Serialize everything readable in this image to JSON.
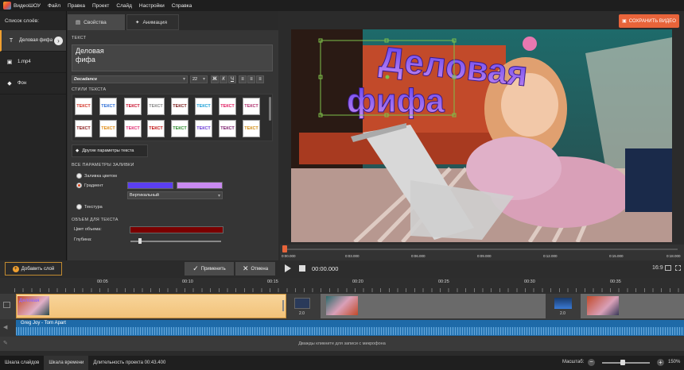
{
  "menu": {
    "app": "ВидеоШОУ",
    "items": [
      "Файл",
      "Правка",
      "Проект",
      "Слайд",
      "Настройки",
      "Справка"
    ]
  },
  "left": {
    "header": "Список слоёв:",
    "layers": [
      {
        "label": "Деловая фифа",
        "icon": "T"
      },
      {
        "label": "1.mp4",
        "icon": "film-icon"
      },
      {
        "label": "Фон",
        "icon": "paint-bucket-icon"
      }
    ]
  },
  "props": {
    "tab_properties": "Свойства",
    "tab_animation": "Анимация",
    "text_label": "ТЕКСТ",
    "text_value": "Деловая\nфифа",
    "font": "Decadance",
    "size": "22",
    "styles_label": "СТИЛИ ТЕКСТА",
    "style_word": "ТЕКСТ",
    "more_params": "Другие параметры текста",
    "fill_label": "ВСЕ ПАРАМЕТРЫ ЗАЛИВКИ",
    "fill_color": "Заливка цветом",
    "gradient": "Градиент",
    "gradient_type": "Вертикальный",
    "texture": "Текстура",
    "volume_label": "ОБЪЕМ ДЛЯ ТЕКСТА",
    "volume_color": "Цвет объема:",
    "depth": "Глубина:",
    "grad_color1": "#5b3ff0",
    "grad_color2": "#c98af0",
    "volume_swatch": "#7a0000"
  },
  "preview": {
    "title_line1": "Деловая",
    "title_line2": "фифа"
  },
  "save_button": "СОХРАНИТЬ ВИДЕО",
  "preview_ruler": [
    "0:00.000",
    "0:03.000",
    "0:06.000",
    "0:09.000",
    "0:12.000",
    "0:15.000",
    "0:18.000"
  ],
  "player": {
    "time": "00:00.000",
    "ratio": "16:9"
  },
  "bottom": {
    "add_layer": "Добавить слой",
    "apply": "Применить",
    "cancel": "Отмена"
  },
  "timeline_ruler": [
    "00:05",
    "00:10",
    "00:15",
    "00:20",
    "00:25",
    "00:30",
    "00:35"
  ],
  "transitions": [
    "2.0",
    "2.0"
  ],
  "audio_track": "Greg Joy - Torn Apart",
  "mic_hint": "Дважды кликните для записи с микрофона",
  "status": {
    "tab_slides": "Шкала слайдов",
    "tab_timeline": "Шкала времени",
    "duration": "Длительность проекта 00:43.400",
    "zoom_label": "Масштаб:",
    "zoom_value": "150%"
  }
}
